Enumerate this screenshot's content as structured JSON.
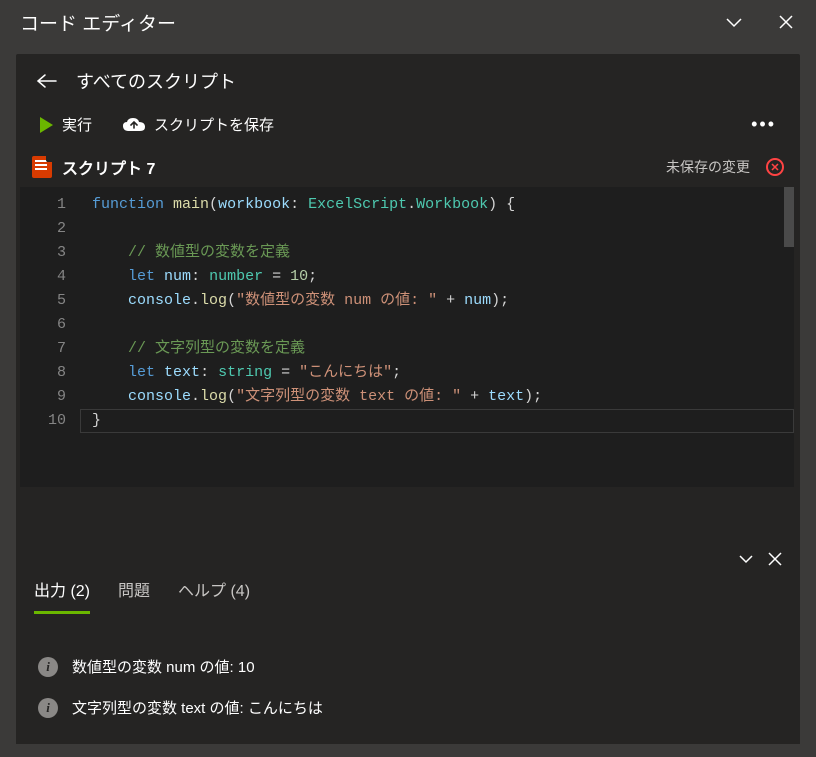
{
  "title_bar": {
    "title": "コード エディター"
  },
  "nav": {
    "all_scripts": "すべてのスクリプト"
  },
  "toolbar": {
    "run": "実行",
    "save": "スクリプトを保存"
  },
  "script": {
    "name": "スクリプト 7",
    "unsaved": "未保存の変更"
  },
  "code": {
    "lines": [
      {
        "n": 1,
        "html": "<span class='kw'>function</span> <span class='fn'>main</span><span class='pn'>(</span><span class='id'>workbook</span><span class='pn'>:</span> <span class='tp'>ExcelScript</span><span class='pn'>.</span><span class='tp'>Workbook</span><span class='pn'>) {</span>"
      },
      {
        "n": 2,
        "html": ""
      },
      {
        "n": 3,
        "html": "    <span class='cm'>// 数値型の変数を定義</span>"
      },
      {
        "n": 4,
        "html": "    <span class='kw'>let</span> <span class='id'>num</span><span class='pn'>:</span> <span class='tp'>number</span> <span class='pn'>=</span> <span class='num'>10</span><span class='pn'>;</span>"
      },
      {
        "n": 5,
        "html": "    <span class='id'>console</span><span class='pn'>.</span><span class='fn'>log</span><span class='pn'>(</span><span class='str'>\"数値型の変数 num の値: \"</span> <span class='pn'>+</span> <span class='id'>num</span><span class='pn'>);</span>"
      },
      {
        "n": 6,
        "html": ""
      },
      {
        "n": 7,
        "html": "    <span class='cm'>// 文字列型の変数を定義</span>"
      },
      {
        "n": 8,
        "html": "    <span class='kw'>let</span> <span class='id'>text</span><span class='pn'>:</span> <span class='tp'>string</span> <span class='pn'>=</span> <span class='str'>\"こんにちは\"</span><span class='pn'>;</span>"
      },
      {
        "n": 9,
        "html": "    <span class='id'>console</span><span class='pn'>.</span><span class='fn'>log</span><span class='pn'>(</span><span class='str'>\"文字列型の変数 text の値: \"</span> <span class='pn'>+</span> <span class='id'>text</span><span class='pn'>);</span>"
      },
      {
        "n": 10,
        "html": "<span class='pn'>}</span>"
      }
    ]
  },
  "tabs": {
    "output": "出力 (2)",
    "problems": "問題",
    "help": "ヘルプ (4)"
  },
  "output": {
    "lines": [
      "数値型の変数 num の値: 10",
      "文字列型の変数 text の値: こんにちは"
    ]
  }
}
